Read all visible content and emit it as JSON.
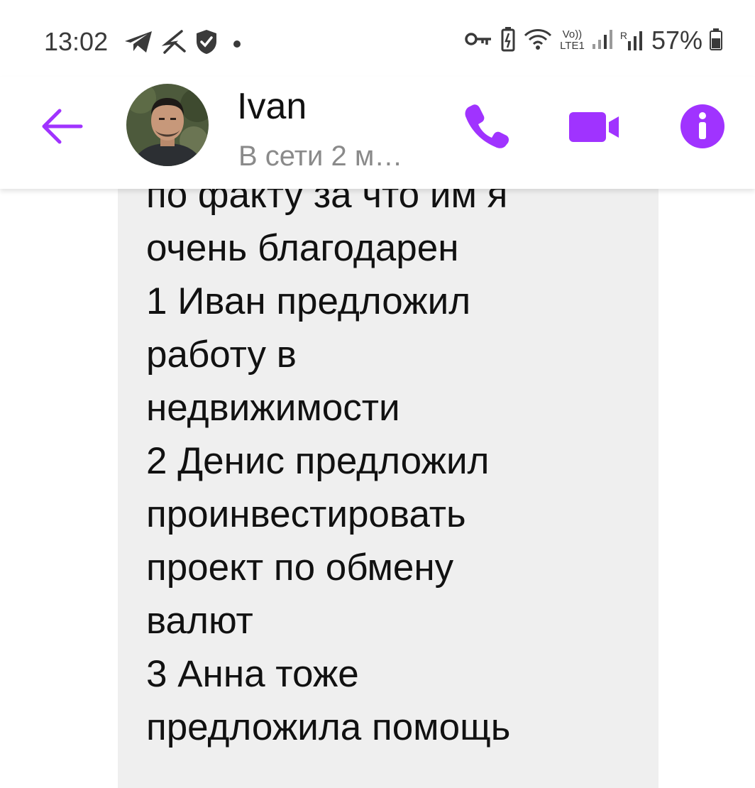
{
  "status_bar": {
    "time": "13:02",
    "battery_percent": "57%",
    "icons": [
      "telegram-icon",
      "gesture-icon",
      "shield-icon",
      "dot-icon",
      "key-icon",
      "battery-saver-icon",
      "wifi-icon",
      "volte-icon",
      "signal-icon",
      "roaming-signal-icon",
      "battery-icon"
    ],
    "network_label_top": "Vo))",
    "network_label_bottom": "LTE1",
    "roaming_label": "R"
  },
  "header": {
    "contact_name": "Ivan",
    "contact_status": "В сети 2 м…",
    "icons": [
      "back-arrow-icon",
      "phone-icon",
      "video-camera-icon",
      "info-icon"
    ]
  },
  "colors": {
    "accent": "#A033FF",
    "bubble_background": "#EFEFEF",
    "text_primary": "#111111",
    "text_secondary": "#8A8A8A"
  },
  "message": {
    "lines": [
      "по факту за что им я",
      "очень благодарен",
      "1 Иван предложил",
      "работу в",
      "недвижимости",
      "2 Денис предложил",
      "проинвестировать",
      "проект по обмену",
      "валют",
      "3 Анна тоже",
      "предложила помощь"
    ]
  }
}
